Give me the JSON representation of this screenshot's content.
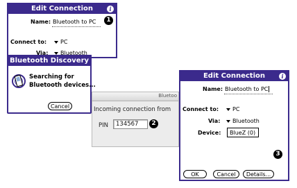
{
  "dialog1": {
    "title": "Edit Connection",
    "name_label": "Name:",
    "name_value": "Bluetooth to PC",
    "connect_label": "Connect to:",
    "connect_value": "PC",
    "via_label": "Via:",
    "via_value": "Bluetooth",
    "callout": "1"
  },
  "discovery": {
    "title": "Bluetooth Discovery",
    "message_line1": "Searching for",
    "message_line2": "Bluetooth devices...",
    "cancel_label": "Cancel"
  },
  "mac": {
    "title": "Bluetoo",
    "prompt": "Incoming connection from",
    "pin_label": "PIN",
    "pin_value": "134567",
    "callout": "2"
  },
  "dialog2": {
    "title": "Edit Connection",
    "name_label": "Name:",
    "name_value": "Bluetooth to PC",
    "connect_label": "Connect to:",
    "connect_value": "PC",
    "via_label": "Via:",
    "via_value": "Bluetooth",
    "device_label": "Device:",
    "device_value": "BlueZ (0)",
    "callout": "3",
    "ok_label": "OK",
    "cancel_label": "Cancel",
    "details_label": "Details..."
  },
  "colors": {
    "palm_accent": "#3b2a8c",
    "callout": "#000000",
    "mac_bg": "#ececec"
  }
}
